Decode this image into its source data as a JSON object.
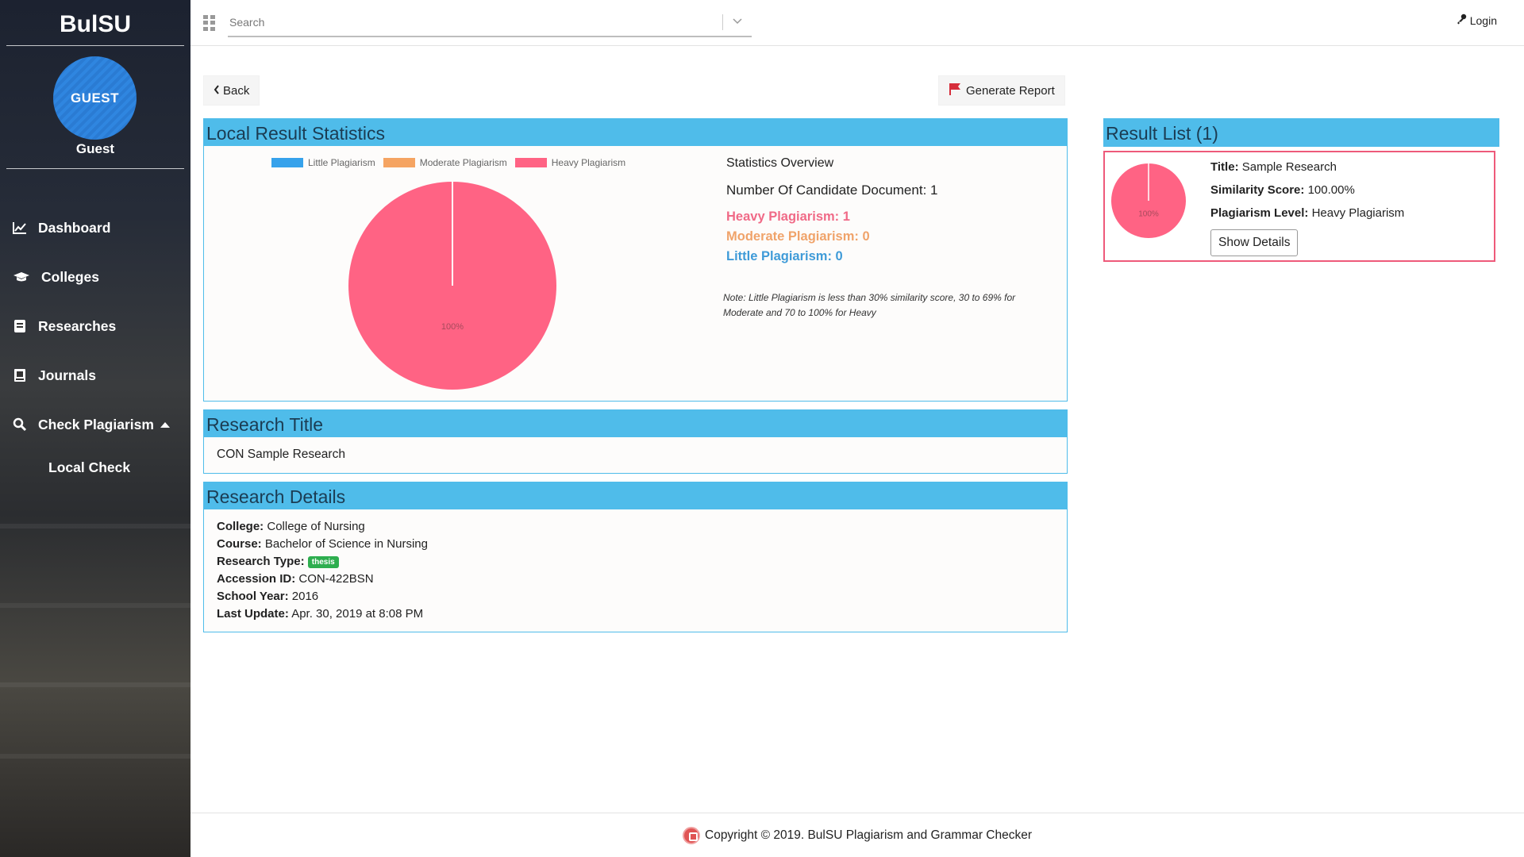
{
  "sidebar": {
    "brand": "BulSU",
    "avatar_text": "GUEST",
    "user_name": "Guest",
    "nav": [
      {
        "label": "Dashboard",
        "icon": "chart-line-icon"
      },
      {
        "label": "Colleges",
        "icon": "graduation-cap-icon"
      },
      {
        "label": "Researches",
        "icon": "book-icon"
      },
      {
        "label": "Journals",
        "icon": "journal-icon"
      },
      {
        "label": "Check Plagiarism",
        "icon": "search-icon"
      }
    ],
    "sub_item": "Local Check"
  },
  "topbar": {
    "search_placeholder": "Search",
    "login_label": "Login"
  },
  "toolbar": {
    "back_label": "Back",
    "report_label": "Generate Report"
  },
  "statistics": {
    "title": "Local Result Statistics",
    "legend": [
      {
        "label": "Little Plagiarism",
        "color": "#36a2eb"
      },
      {
        "label": "Moderate Plagiarism",
        "color": "#f5a462"
      },
      {
        "label": "Heavy Plagiarism",
        "color": "#ff6384"
      }
    ],
    "pie_label": "100%",
    "overview_title": "Statistics Overview",
    "candidate_count": "Number Of Candidate Document: 1",
    "heavy": "Heavy Plagiarism: 1",
    "moderate": "Moderate Plagiarism: 0",
    "little": "Little Plagiarism: 0",
    "note": "Note: Little Plagiarism is less than 30% similarity score, 30 to 69% for Moderate and 70 to 100% for Heavy"
  },
  "chart_data": {
    "type": "pie",
    "categories": [
      "Little Plagiarism",
      "Moderate Plagiarism",
      "Heavy Plagiarism"
    ],
    "values": [
      0,
      0,
      1
    ],
    "colors": [
      "#36a2eb",
      "#f5a462",
      "#ff6384"
    ],
    "slice_labels": [
      "",
      "",
      "100%"
    ],
    "legend_position": "top"
  },
  "research_title": {
    "title": "Research Title",
    "value": "CON Sample Research"
  },
  "research_details": {
    "title": "Research Details",
    "college_label": "College:",
    "college": "College of Nursing",
    "course_label": "Course:",
    "course": "Bachelor of Science in Nursing",
    "type_label": "Research Type:",
    "type": "thesis",
    "accession_label": "Accession ID:",
    "accession": "CON-422BSN",
    "year_label": "School Year:",
    "year": "2016",
    "update_label": "Last Update:",
    "update": "Apr. 30, 2019 at 8:08 PM"
  },
  "result_list": {
    "title": "Result List (1)",
    "pie_label": "100%",
    "title_label": "Title:",
    "title_value": "Sample Research",
    "score_label": "Similarity Score:",
    "score_value": "100.00%",
    "level_label": "Plagiarism Level:",
    "level_value": "Heavy Plagiarism",
    "button_label": "Show Details"
  },
  "footer": {
    "text": "Copyright © 2019. BulSU Plagiarism and Grammar Checker"
  }
}
